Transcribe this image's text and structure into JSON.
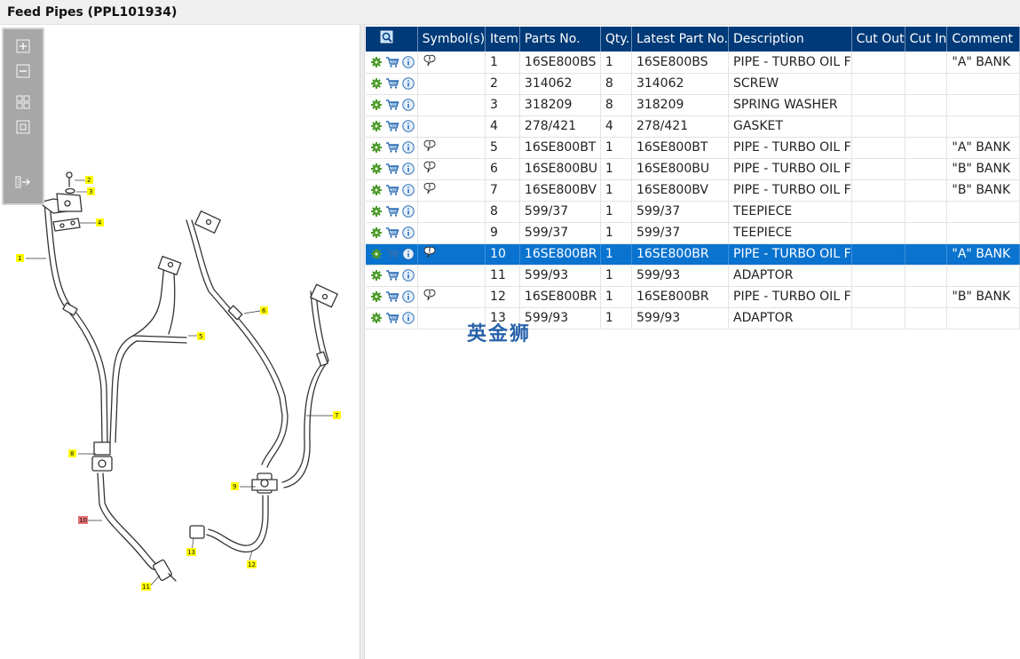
{
  "window": {
    "title": "Feed Pipes (PPL101934)"
  },
  "zoom_toolbar": {
    "buttons": [
      {
        "name": "zoom-in-button",
        "icon": "plus-icon"
      },
      {
        "name": "zoom-out-button",
        "icon": "minus-icon"
      },
      {
        "name": "fit-all-button",
        "icon": "grid-icon"
      },
      {
        "name": "fit-window-button",
        "icon": "square-icon"
      },
      {
        "name": "toggle-panel-button",
        "icon": "panel-arrow-icon"
      }
    ]
  },
  "diagram": {
    "callouts": [
      "1",
      "2",
      "3",
      "4",
      "5",
      "6",
      "7",
      "8",
      "9",
      "10",
      "11",
      "12",
      "13"
    ],
    "highlighted_callout": "10",
    "callout_color": "#ffff00",
    "highlight_color": "#e57373"
  },
  "table": {
    "header_color": "#003a78",
    "selected_color": "#0a73cf",
    "columns": {
      "search": "search-parts-icon",
      "symbols": "Symbol(s)",
      "item": "Item",
      "parts_no": "Parts No.",
      "qty": "Qty.",
      "latest_part_no": "Latest Part No.",
      "description": "Description",
      "cut_out": "Cut Out",
      "cut_in": "Cut In",
      "comment": "Comment"
    },
    "rows": [
      {
        "symbol": true,
        "item": "1",
        "parts_no": "16SE800BS",
        "qty": "1",
        "latest": "16SE800BS",
        "description": "PIPE - TURBO OIL F",
        "cut_out": "",
        "cut_in": "",
        "comment": "\"A\" BANK"
      },
      {
        "symbol": false,
        "item": "2",
        "parts_no": "314062",
        "qty": "8",
        "latest": "314062",
        "description": "SCREW",
        "cut_out": "",
        "cut_in": "",
        "comment": ""
      },
      {
        "symbol": false,
        "item": "3",
        "parts_no": "318209",
        "qty": "8",
        "latest": "318209",
        "description": "SPRING WASHER",
        "cut_out": "",
        "cut_in": "",
        "comment": ""
      },
      {
        "symbol": false,
        "item": "4",
        "parts_no": "278/421",
        "qty": "4",
        "latest": "278/421",
        "description": "GASKET",
        "cut_out": "",
        "cut_in": "",
        "comment": ""
      },
      {
        "symbol": true,
        "item": "5",
        "parts_no": "16SE800BT",
        "qty": "1",
        "latest": "16SE800BT",
        "description": "PIPE - TURBO OIL F",
        "cut_out": "",
        "cut_in": "",
        "comment": "\"A\" BANK"
      },
      {
        "symbol": true,
        "item": "6",
        "parts_no": "16SE800BU",
        "qty": "1",
        "latest": "16SE800BU",
        "description": "PIPE - TURBO OIL F",
        "cut_out": "",
        "cut_in": "",
        "comment": "\"B\" BANK"
      },
      {
        "symbol": true,
        "item": "7",
        "parts_no": "16SE800BV",
        "qty": "1",
        "latest": "16SE800BV",
        "description": "PIPE - TURBO OIL F",
        "cut_out": "",
        "cut_in": "",
        "comment": "\"B\" BANK"
      },
      {
        "symbol": false,
        "item": "8",
        "parts_no": "599/37",
        "qty": "1",
        "latest": "599/37",
        "description": "TEEPIECE",
        "cut_out": "",
        "cut_in": "",
        "comment": ""
      },
      {
        "symbol": false,
        "item": "9",
        "parts_no": "599/37",
        "qty": "1",
        "latest": "599/37",
        "description": "TEEPIECE",
        "cut_out": "",
        "cut_in": "",
        "comment": ""
      },
      {
        "symbol": true,
        "item": "10",
        "parts_no": "16SE800BR",
        "qty": "1",
        "latest": "16SE800BR",
        "description": "PIPE - TURBO OIL F",
        "cut_out": "",
        "cut_in": "",
        "comment": "\"A\" BANK",
        "selected": true
      },
      {
        "symbol": false,
        "item": "11",
        "parts_no": "599/93",
        "qty": "1",
        "latest": "599/93",
        "description": "ADAPTOR",
        "cut_out": "",
        "cut_in": "",
        "comment": ""
      },
      {
        "symbol": true,
        "item": "12",
        "parts_no": "16SE800BR",
        "qty": "1",
        "latest": "16SE800BR",
        "description": "PIPE - TURBO OIL F",
        "cut_out": "",
        "cut_in": "",
        "comment": "\"B\" BANK"
      },
      {
        "symbol": false,
        "item": "13",
        "parts_no": "599/93",
        "qty": "1",
        "latest": "599/93",
        "description": "ADAPTOR",
        "cut_out": "",
        "cut_in": "",
        "comment": ""
      }
    ],
    "row_icons": [
      "gear-icon",
      "cart-icon",
      "info-icon"
    ]
  },
  "watermark": "英金狮"
}
